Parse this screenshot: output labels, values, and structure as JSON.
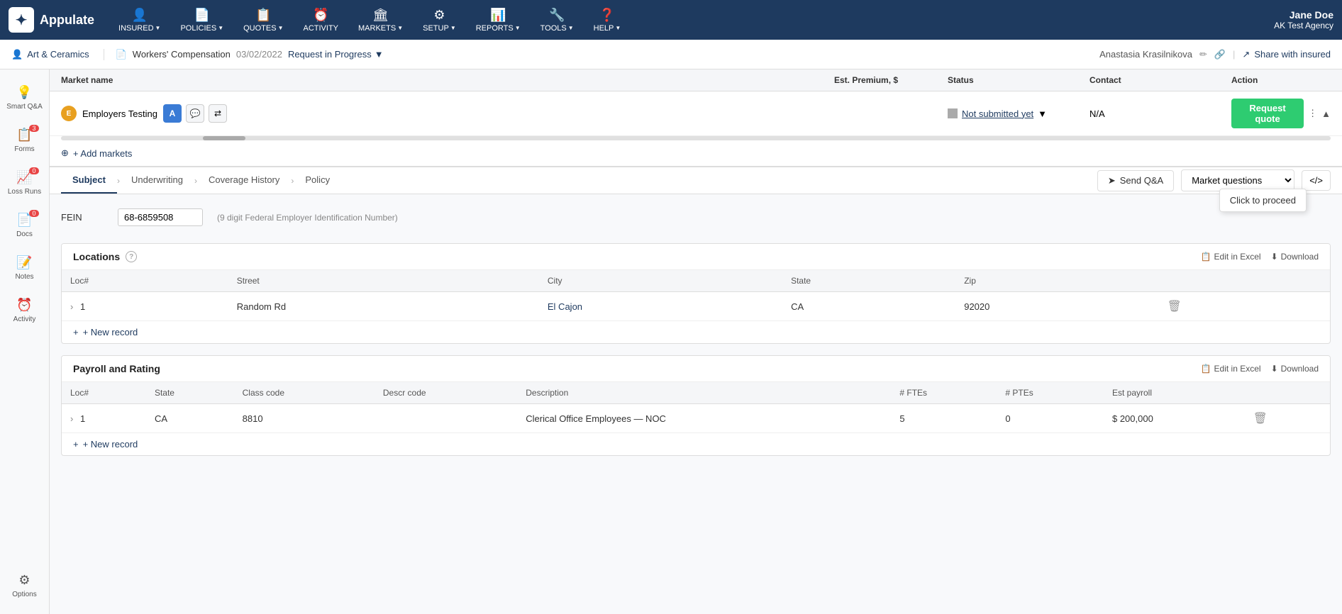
{
  "app": {
    "name": "Appulate",
    "logo_char": "A"
  },
  "nav": {
    "items": [
      {
        "id": "insured",
        "label": "INSURED",
        "icon": "👤",
        "has_arrow": true
      },
      {
        "id": "policies",
        "label": "POLICIES",
        "icon": "📄",
        "has_arrow": true
      },
      {
        "id": "quotes",
        "label": "QUOTES",
        "icon": "📋",
        "has_arrow": true
      },
      {
        "id": "activity",
        "label": "ACTIVITY",
        "icon": "⏰",
        "has_arrow": false
      },
      {
        "id": "markets",
        "label": "MARKETS",
        "icon": "🏛",
        "has_arrow": true
      },
      {
        "id": "setup",
        "label": "SETUP",
        "icon": "⚙",
        "has_arrow": true
      },
      {
        "id": "reports",
        "label": "REPORTS",
        "icon": "📊",
        "has_arrow": true
      },
      {
        "id": "tools",
        "label": "TOOLS",
        "icon": "🔧",
        "has_arrow": true
      },
      {
        "id": "help",
        "label": "HELP",
        "icon": "?",
        "has_arrow": true
      }
    ],
    "user_name": "Jane Doe",
    "user_agency": "AK Test Agency"
  },
  "breadcrumb": {
    "insured_name": "Art & Ceramics",
    "policy_type": "Workers' Compensation",
    "policy_date": "03/02/2022",
    "status": "Request in Progress",
    "user": "Anastasia Krasilnikova",
    "share_label": "Share with insured"
  },
  "markets_table": {
    "headers": [
      "Market name",
      "Est. Premium, $",
      "Status",
      "Contact",
      "Action"
    ],
    "rows": [
      {
        "name": "Employers Testing",
        "premium": "",
        "status": "Not submitted yet",
        "contact": "N/A",
        "action": "Request quote"
      }
    ],
    "add_markets_label": "+ Add markets",
    "tooltip_text": "Click to proceed"
  },
  "tabs": {
    "items": [
      {
        "id": "subject",
        "label": "Subject",
        "active": true
      },
      {
        "id": "underwriting",
        "label": "Underwriting",
        "active": false
      },
      {
        "id": "coverage_history",
        "label": "Coverage History",
        "active": false
      },
      {
        "id": "policy",
        "label": "Policy",
        "active": false
      }
    ],
    "send_qanda": "Send Q&A",
    "market_questions": "Market questions",
    "code_btn": "</>",
    "send_icon": "➤"
  },
  "form": {
    "fein_label": "FEIN",
    "fein_value": "68-6859508",
    "fein_hint": "(9 digit Federal Employer Identification Number)",
    "locations_section": {
      "title": "Locations",
      "edit_excel": "Edit in Excel",
      "download": "Download",
      "columns": [
        "Loc#",
        "Street",
        "City",
        "State",
        "Zip"
      ],
      "rows": [
        {
          "loc": "1",
          "street": "Random Rd",
          "city": "El Cajon",
          "state": "CA",
          "zip": "92020"
        }
      ],
      "new_record": "+ New record"
    },
    "payroll_section": {
      "title": "Payroll and Rating",
      "edit_excel": "Edit in Excel",
      "download": "Download",
      "columns": [
        "Loc#",
        "State",
        "Class code",
        "Descr code",
        "Description",
        "# FTEs",
        "# PTEs",
        "Est payroll"
      ],
      "rows": [
        {
          "loc": "1",
          "state": "CA",
          "class_code": "8810",
          "descr_code": "",
          "description": "Clerical Office Employees — NOC",
          "ftes": "5",
          "ptes": "0",
          "est_payroll": "$ 200,000"
        }
      ],
      "new_record": "+ New record"
    }
  },
  "sidebar": {
    "items": [
      {
        "id": "smart-qa",
        "label": "Smart Q&A",
        "icon": "💡",
        "badge": null
      },
      {
        "id": "forms",
        "label": "Forms",
        "icon": "📋",
        "badge": "3"
      },
      {
        "id": "loss-runs",
        "label": "Loss Runs",
        "icon": "📈",
        "badge": "0"
      },
      {
        "id": "docs",
        "label": "Docs",
        "icon": "📄",
        "badge": "0"
      },
      {
        "id": "notes",
        "label": "Notes",
        "icon": "📝",
        "badge": null
      },
      {
        "id": "activity",
        "label": "Activity",
        "icon": "⏰",
        "badge": null
      },
      {
        "id": "options",
        "label": "Options",
        "icon": "⚙",
        "badge": null
      }
    ]
  }
}
